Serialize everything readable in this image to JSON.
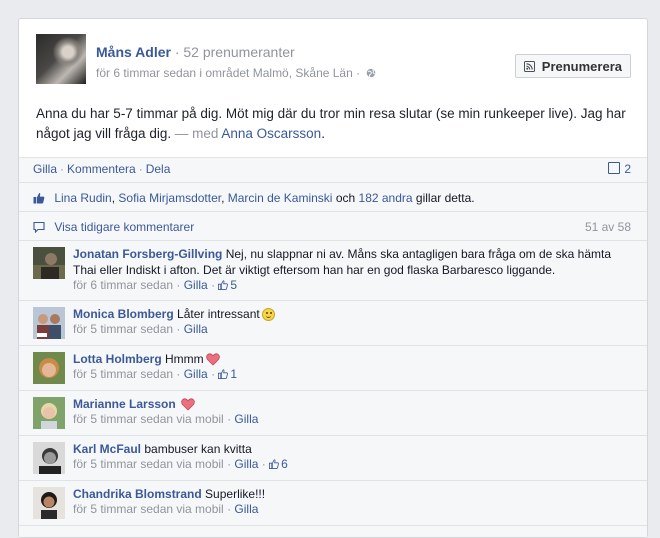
{
  "post": {
    "author": "Måns Adler",
    "subscribers": "· 52 prenumeranter",
    "meta": "för 6 timmar sedan i området Malmö, Skåne Län ·",
    "subscribe_button": "Prenumerera",
    "text": "Anna du har 5-7 timmar på dig. Möt mig där du tror min resa slutar (se min runkeeper live). Jag har något jag vill fråga dig.",
    "with_label": "— med",
    "tagged": "Anna Oscarsson",
    "tagged_end": "."
  },
  "actions": {
    "like": "Gilla",
    "comment": "Kommentera",
    "share": "Dela",
    "comment_count": "2"
  },
  "likes": {
    "names": [
      "Lina Rudin",
      "Sofia Mirjamsdotter",
      "Marcin de Kaminski"
    ],
    "and": "och",
    "others": "182 andra",
    "suffix": "gillar detta."
  },
  "previous": {
    "label": "Visa tidigare kommentarer",
    "pages": "51 av 58"
  },
  "comments": [
    {
      "name": "Jonatan Forsberg-Gillving",
      "text": "Nej, nu slappnar ni av. Måns ska antagligen bara fråga om de ska hämta Thai eller Indiskt i afton. Det är viktigt eftersom han har en god flaska Barbaresco liggande.",
      "time": "för 6 timmar sedan",
      "like": "Gilla",
      "likes": "5"
    },
    {
      "name": "Monica Blomberg",
      "text": "Låter intressant",
      "time": "för 5 timmar sedan",
      "like": "Gilla"
    },
    {
      "name": "Lotta Holmberg",
      "text": "Hmmm",
      "time": "för 5 timmar sedan",
      "like": "Gilla",
      "likes": "1"
    },
    {
      "name": "Marianne Larsson",
      "text": "",
      "time": "för 5 timmar sedan via mobil",
      "like": "Gilla"
    },
    {
      "name": "Karl McFaul",
      "text": "bambuser kan kvitta",
      "time": "för 5 timmar sedan via mobil",
      "like": "Gilla",
      "likes": "6"
    },
    {
      "name": "Chandrika Blomstrand",
      "text": "Superlike!!!",
      "time": "för 5 timmar sedan via mobil",
      "like": "Gilla"
    }
  ],
  "colors": {
    "link": "#3b5998",
    "muted": "#90949c",
    "ufi_bg": "#f6f7f9"
  }
}
